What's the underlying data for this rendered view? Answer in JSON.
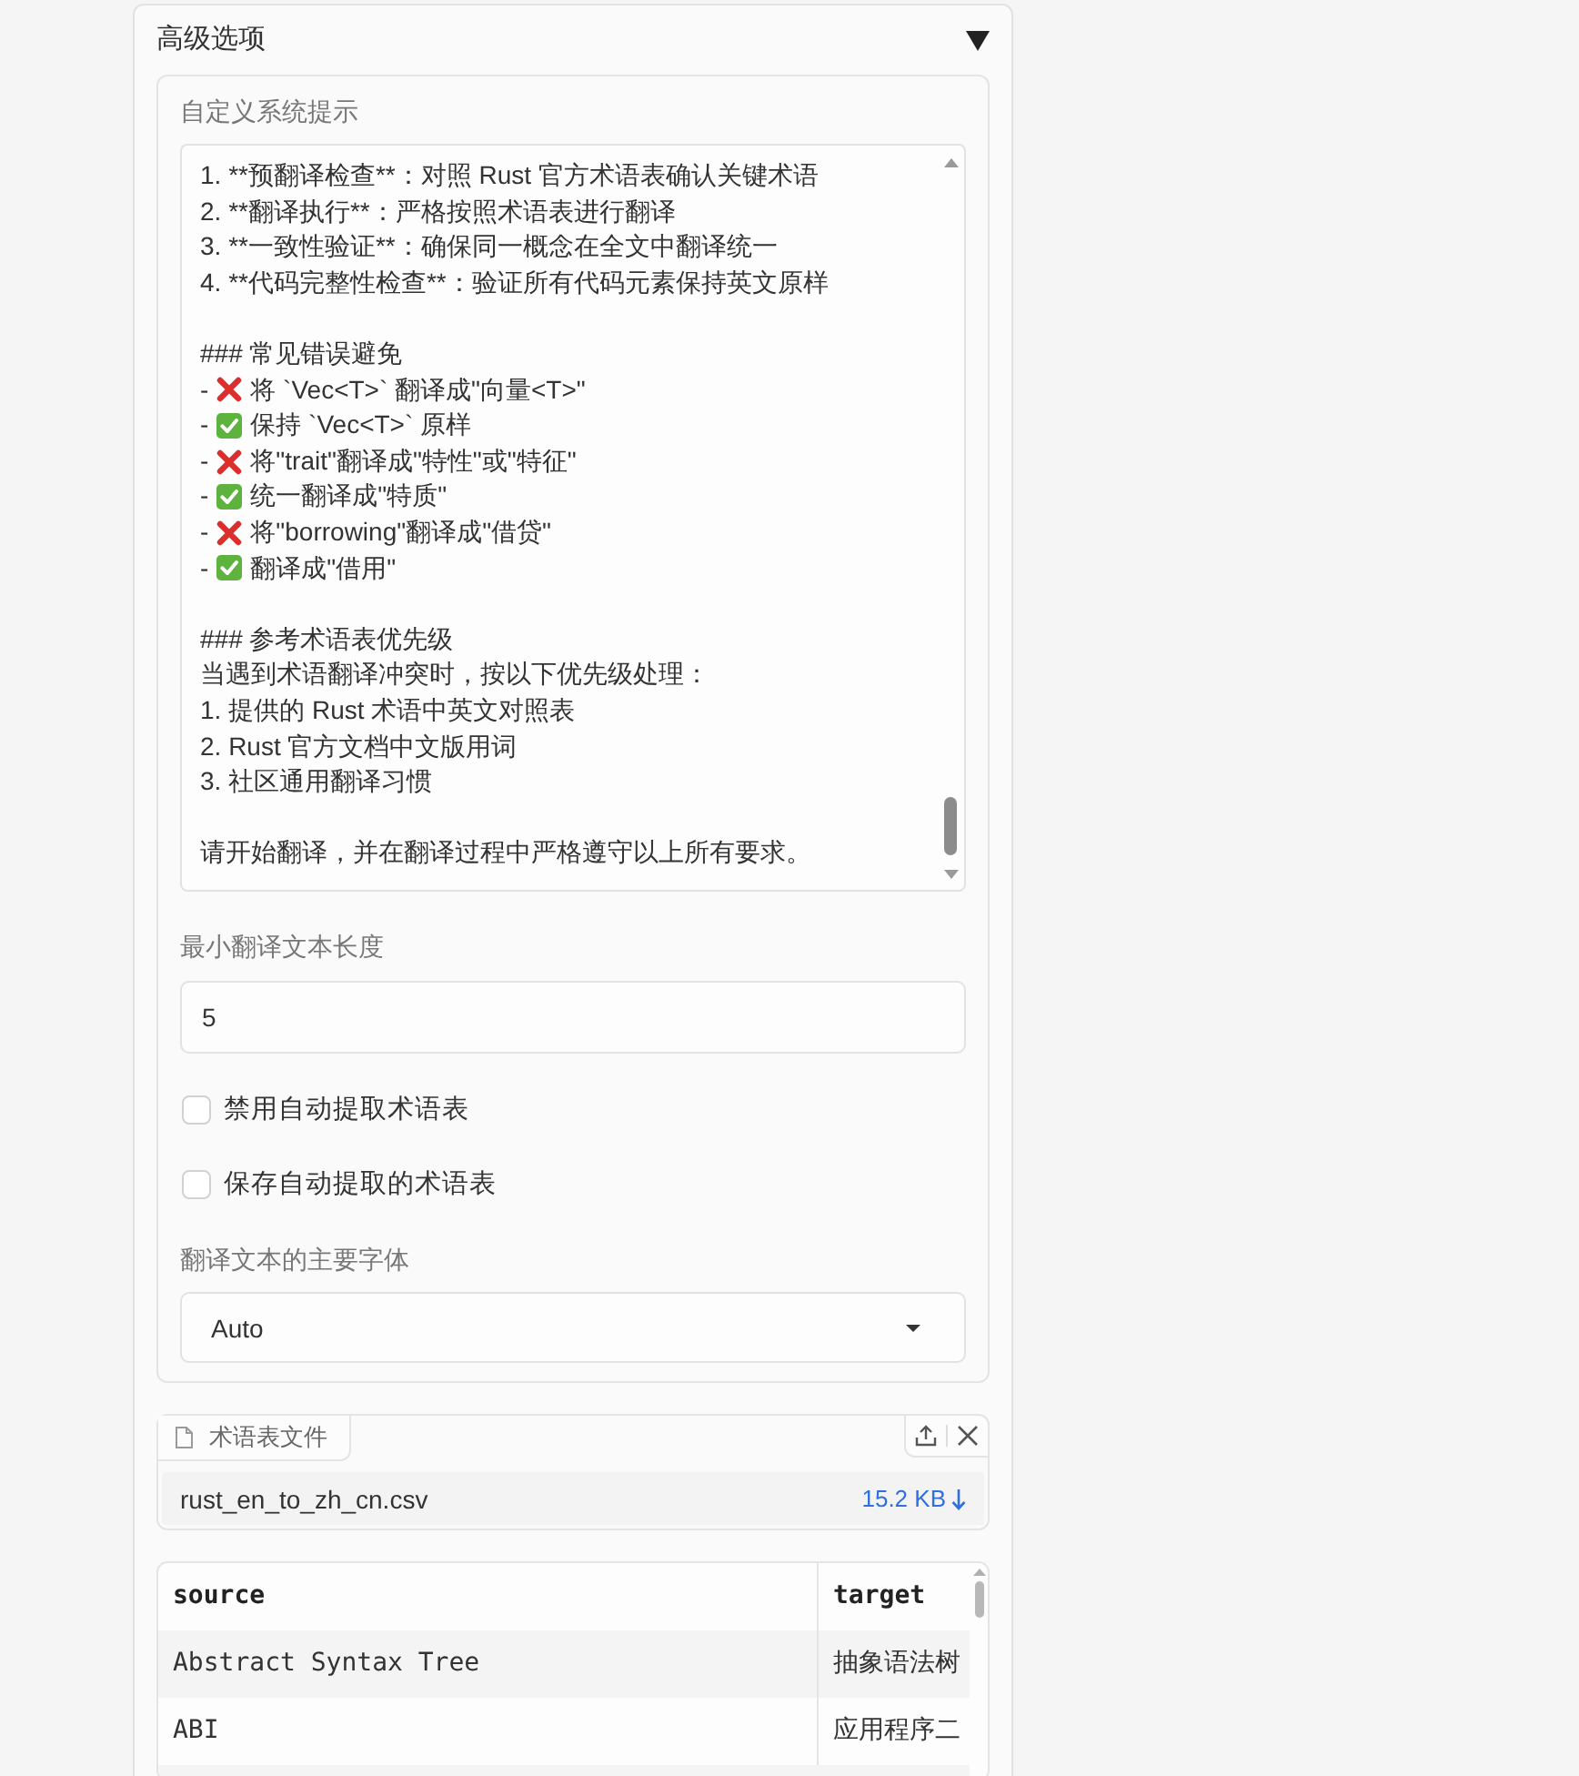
{
  "accordion": {
    "title": "高级选项",
    "expanded": true
  },
  "system_prompt": {
    "label": "自定义系统提示",
    "lines": [
      {
        "kind": "text",
        "text": "1. **预翻译检查**：对照 Rust 官方术语表确认关键术语"
      },
      {
        "kind": "text",
        "text": "2. **翻译执行**：严格按照术语表进行翻译"
      },
      {
        "kind": "text",
        "text": "3. **一致性验证**：确保同一概念在全文中翻译统一"
      },
      {
        "kind": "text",
        "text": "4. **代码完整性检查**：验证所有代码元素保持英文原样"
      },
      {
        "kind": "blank"
      },
      {
        "kind": "text",
        "text": "### 常见错误避免"
      },
      {
        "kind": "wrong",
        "prefix": "-",
        "text": "将 `Vec<T>` 翻译成\"向量<T>\""
      },
      {
        "kind": "right",
        "prefix": "-",
        "text": "保持 `Vec<T>` 原样"
      },
      {
        "kind": "wrong",
        "prefix": "-",
        "text": "将\"trait\"翻译成\"特性\"或\"特征\""
      },
      {
        "kind": "right",
        "prefix": "-",
        "text": "统一翻译成\"特质\""
      },
      {
        "kind": "wrong",
        "prefix": "-",
        "text": "将\"borrowing\"翻译成\"借贷\""
      },
      {
        "kind": "right",
        "prefix": "-",
        "text": "翻译成\"借用\""
      },
      {
        "kind": "blank"
      },
      {
        "kind": "text",
        "text": "### 参考术语表优先级"
      },
      {
        "kind": "text",
        "text": "当遇到术语翻译冲突时，按以下优先级处理："
      },
      {
        "kind": "text",
        "text": "1. 提供的 Rust 术语中英文对照表"
      },
      {
        "kind": "text",
        "text": "2. Rust 官方文档中文版用词"
      },
      {
        "kind": "text",
        "text": "3. 社区通用翻译习惯"
      },
      {
        "kind": "blank"
      },
      {
        "kind": "text",
        "text": "请开始翻译，并在翻译过程中严格遵守以上所有要求。"
      }
    ]
  },
  "min_length": {
    "label": "最小翻译文本长度",
    "value": "5"
  },
  "options": [
    {
      "label": "禁用自动提取术语表",
      "checked": false
    },
    {
      "label": "保存自动提取的术语表",
      "checked": false
    }
  ],
  "main_font": {
    "label": "翻译文本的主要字体",
    "value": "Auto"
  },
  "glossary_file": {
    "label": "术语表文件",
    "file_name": "rust_en_to_zh_cn.csv",
    "size": "15.2 KB"
  },
  "glossary_table": {
    "columns": [
      "source",
      "target"
    ],
    "rows": [
      [
        "Abstract Syntax Tree",
        "抽象语法树"
      ],
      [
        "ABI",
        "应用程序二"
      ]
    ]
  }
}
